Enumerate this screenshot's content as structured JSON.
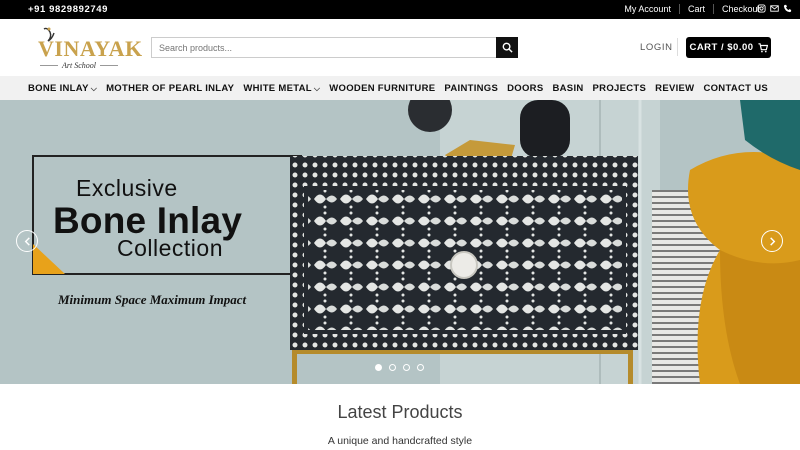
{
  "topbar": {
    "phone": "+91 9829892749",
    "links": [
      "My Account",
      "Cart",
      "Checkout"
    ],
    "icons": [
      "instagram-icon",
      "email-icon",
      "phone-icon"
    ]
  },
  "header": {
    "logo_text": "VINAYAK",
    "logo_sub": "Art School",
    "search_placeholder": "Search products...",
    "login_label": "LOGIN",
    "cart_label": "CART / $0.00"
  },
  "nav": {
    "items": [
      {
        "label": "BONE INLAY",
        "dropdown": true
      },
      {
        "label": "MOTHER OF PEARL INLAY",
        "dropdown": false
      },
      {
        "label": "WHITE METAL",
        "dropdown": true
      },
      {
        "label": "WOODEN FURNITURE",
        "dropdown": false
      },
      {
        "label": "PAINTINGS",
        "dropdown": false
      },
      {
        "label": "DOORS",
        "dropdown": false
      },
      {
        "label": "BASIN",
        "dropdown": false
      },
      {
        "label": "PROJECTS",
        "dropdown": false
      },
      {
        "label": "REVIEW",
        "dropdown": false
      },
      {
        "label": "CONTACT US",
        "dropdown": false
      }
    ]
  },
  "hero": {
    "line1": "Exclusive",
    "line2": "Bone Inlay",
    "line3": "Collection",
    "tagline": "Minimum Space Maximum Impact",
    "slide_count": 4,
    "active_slide": 1
  },
  "latest": {
    "title": "Latest Products",
    "subtitle": "A unique and handcrafted style"
  },
  "colors": {
    "brand_gold": "#c9a24d",
    "accent_yellow": "#e8a21a",
    "topbar": "#000000",
    "nav_bg": "#f1f1f1"
  }
}
